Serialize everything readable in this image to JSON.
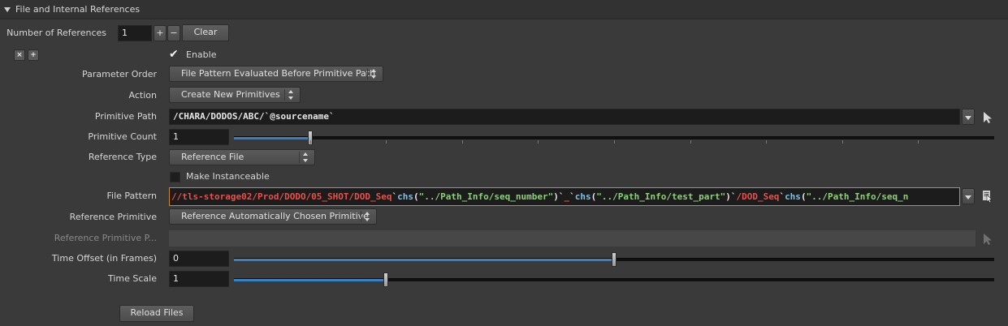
{
  "section": {
    "title": "File and Internal References"
  },
  "num_refs": {
    "label": "Number of References",
    "value": "1",
    "plus": "+",
    "minus": "−",
    "clear": "Clear"
  },
  "multiparm_buttons": {
    "remove": "×",
    "insert": "+"
  },
  "enable": {
    "label": "Enable",
    "checked": true
  },
  "param_order": {
    "label": "Parameter Order",
    "value": "File Pattern Evaluated Before Primitive Path"
  },
  "action": {
    "label": "Action",
    "value": "Create New Primitives"
  },
  "prim_path": {
    "label": "Primitive Path",
    "value": "/CHARA/DODOS/ABC/`@sourcename`"
  },
  "prim_count": {
    "label": "Primitive Count",
    "value": "1",
    "slider_fraction": 0.1
  },
  "ref_type": {
    "label": "Reference Type",
    "value": "Reference File"
  },
  "instanceable": {
    "label": "Make Instanceable",
    "checked": false
  },
  "file_pattern": {
    "label": "File Pattern",
    "segments": [
      {
        "text": "//tls-storage02/Prod/DODO/05_SHOT/DOD",
        "color": "red"
      },
      {
        "text": "_Seq",
        "color": "red"
      },
      {
        "text": "`",
        "color": "white"
      },
      {
        "text": "chs",
        "color": "blue"
      },
      {
        "text": "(",
        "color": "white"
      },
      {
        "text": "\"../Path_Info/seq_number\"",
        "color": "green"
      },
      {
        "text": ")`",
        "color": "white"
      },
      {
        "text": "_",
        "color": "red"
      },
      {
        "text": "`",
        "color": "white"
      },
      {
        "text": "chs",
        "color": "blue"
      },
      {
        "text": "(",
        "color": "white"
      },
      {
        "text": "\"../Path_Info/test_part\"",
        "color": "green"
      },
      {
        "text": ")`",
        "color": "white"
      },
      {
        "text": "/DOD_Seq",
        "color": "red"
      },
      {
        "text": "`",
        "color": "white"
      },
      {
        "text": "chs",
        "color": "blue"
      },
      {
        "text": "(",
        "color": "white"
      },
      {
        "text": "\"../Path_Info/seq_n",
        "color": "green"
      }
    ]
  },
  "ref_prim": {
    "label": "Reference Primitive",
    "value": "Reference Automatically Chosen Primitive"
  },
  "ref_prim_path": {
    "label": "Reference Primitive P...",
    "value": ""
  },
  "time_offset": {
    "label": "Time Offset (in Frames)",
    "value": "0",
    "slider_fraction": 0.5
  },
  "time_scale": {
    "label": "Time Scale",
    "value": "1",
    "slider_fraction": 0.2
  },
  "reload": {
    "label": "Reload Files"
  },
  "colors": {
    "red": "#e8504a",
    "blue": "#7fc1e6",
    "green": "#8ed07a",
    "white": "#e8e8e8",
    "accent": "#3a7fc4"
  }
}
